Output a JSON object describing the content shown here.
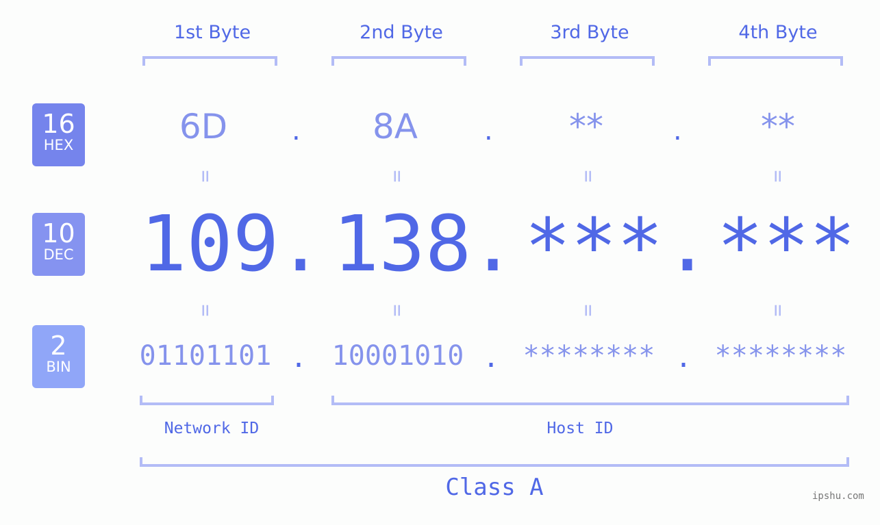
{
  "bytes": [
    {
      "title": "1st Byte",
      "hex": "6D",
      "dec": "109",
      "bin": "01101101"
    },
    {
      "title": "2nd Byte",
      "hex": "8A",
      "dec": "138",
      "bin": "10001010"
    },
    {
      "title": "3rd Byte",
      "hex": "**",
      "dec": "***",
      "bin": "********"
    },
    {
      "title": "4th Byte",
      "hex": "**",
      "dec": "***",
      "bin": "********"
    }
  ],
  "separator": ".",
  "equals": "=",
  "badges": {
    "hex": {
      "num": "16",
      "label": "HEX",
      "color": "#7584ec"
    },
    "dec": {
      "num": "10",
      "label": "DEC",
      "color": "#8593f0"
    },
    "bin": {
      "num": "2",
      "label": "BIN",
      "color": "#90a6f8"
    }
  },
  "sections": {
    "network": "Network ID",
    "host": "Host ID",
    "class": "Class A"
  },
  "watermark": "ipshu.com",
  "colors": {
    "primary": "#5068e6",
    "secondary": "#8593ec",
    "bracket": "#b3bcf6"
  }
}
